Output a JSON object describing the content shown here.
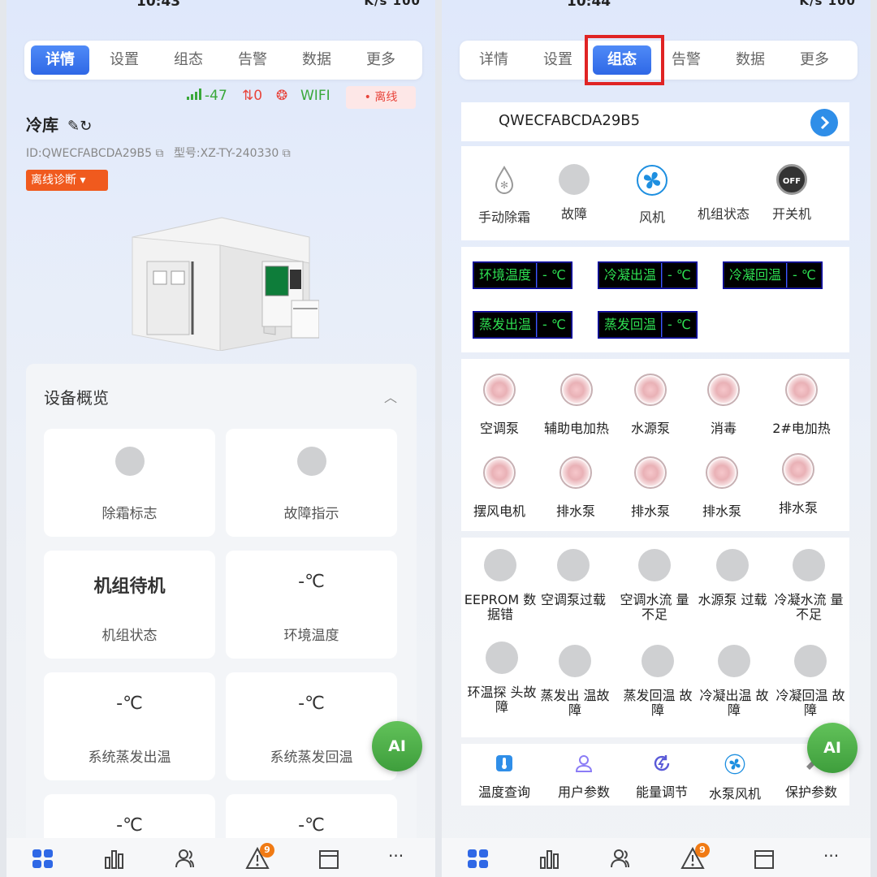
{
  "left": {
    "status": {
      "time": "10:43",
      "indicators": "K/s 100"
    },
    "tabs": [
      "详情",
      "设置",
      "组态",
      "告警",
      "数据",
      "更多"
    ],
    "active_tab": "详情",
    "signal": {
      "strength": "-47",
      "transfer": "0",
      "wifi": "WIFI"
    },
    "offline_badge": "• 离线",
    "device": {
      "name": "冷库",
      "id": "ID:QWECFABCDA29B5",
      "model": "型号:XZ-TY-240330"
    },
    "diag_button": "离线诊断",
    "overview": {
      "title": "设备概览",
      "tiles": [
        {
          "value": "",
          "label": "除霜标志",
          "kind": "dot"
        },
        {
          "value": "",
          "label": "故障指示",
          "kind": "dot"
        },
        {
          "value": "机组待机",
          "label": "机组状态",
          "kind": "bold"
        },
        {
          "value": "-℃",
          "label": "环境温度",
          "kind": "text"
        },
        {
          "value": "-℃",
          "label": "系统蒸发出温",
          "kind": "text"
        },
        {
          "value": "-℃",
          "label": "系统蒸发回温",
          "kind": "text"
        },
        {
          "value": "-℃",
          "label": "",
          "kind": "text"
        },
        {
          "value": "-℃",
          "label": "",
          "kind": "text"
        }
      ]
    },
    "ai": "AI",
    "alarm_count": "9"
  },
  "right": {
    "status": {
      "time": "10:44",
      "indicators": "K/s 100"
    },
    "tabs": [
      "详情",
      "设置",
      "组态",
      "告警",
      "数据",
      "更多"
    ],
    "active_tab": "组态",
    "serial": "QWECFABCDA29B5",
    "status_icons": [
      {
        "label": "手动除霜",
        "icon": "defrost-icon"
      },
      {
        "label": "故障",
        "icon": "fault-dot-icon"
      },
      {
        "label": "风机",
        "icon": "fan-icon"
      },
      {
        "label": "机组状态",
        "icon": "unit-status-icon"
      },
      {
        "label": "开关机",
        "icon": "power-off-icon",
        "text": "OFF"
      }
    ],
    "temps": [
      {
        "key": "环境温度",
        "value": "- ℃"
      },
      {
        "key": "冷凝出温",
        "value": "- ℃"
      },
      {
        "key": "冷凝回温",
        "value": "- ℃"
      },
      {
        "key": "蒸发出温",
        "value": "- ℃"
      },
      {
        "key": "蒸发回温",
        "value": "- ℃"
      }
    ],
    "outputs": [
      "空调泵",
      "辅助电加热",
      "水源泵",
      "消毒",
      "2#电加热",
      "摆风电机",
      "排水泵",
      "排水泵",
      "排水泵",
      "排水泵"
    ],
    "faults": [
      "EEPROM 数据错",
      "空调泵过载",
      "空调水流 量不足",
      "水源泵 过载",
      "冷凝水流 量不足",
      "环温探 头故障",
      "蒸发出 温故障",
      "蒸发回温 故障",
      "冷凝出温 故障",
      "冷凝回温 故障"
    ],
    "tools": [
      "温度查询",
      "用户参数",
      "能量调节",
      "水泵风机",
      "保护参数"
    ],
    "ai": "AI",
    "alarm_count": "9"
  },
  "colors": {
    "accent": "#2f68e6",
    "diag": "#f05a1e",
    "lcd_text": "#2ee052",
    "ai": "#4fae48",
    "highlight": "#e02424"
  }
}
